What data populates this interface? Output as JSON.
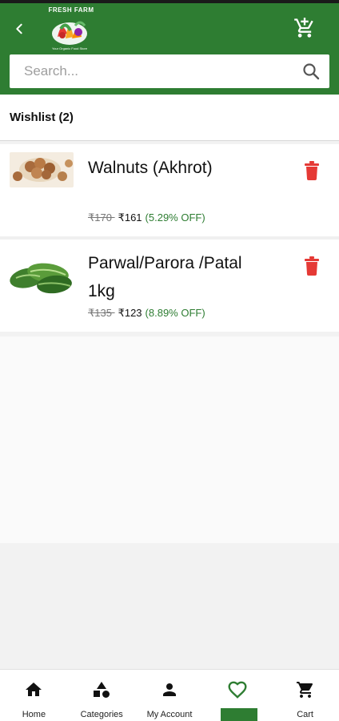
{
  "header": {
    "logo_title": "FRESH FARM",
    "logo_tagline": "Your Organic Food Store",
    "icons": {
      "back": "back-arrow-icon",
      "cart_add": "cart-add-icon"
    },
    "brand_color": "#2e7d32"
  },
  "search": {
    "placeholder": "Search...",
    "value": ""
  },
  "wishlist": {
    "title": "Wishlist (2)",
    "items": [
      {
        "name": "Walnuts (Akhrot)",
        "price_old": "₹170 ",
        "price_new": "₹161",
        "discount": "(5.29% OFF)",
        "image": "walnuts"
      },
      {
        "name": "Parwal/Parora /Patal 1kg",
        "price_old": "₹135 ",
        "price_new": "₹123",
        "discount": "(8.89% OFF)",
        "image": "parwal"
      }
    ]
  },
  "nav": {
    "items": [
      {
        "label": "Home",
        "icon": "home-icon"
      },
      {
        "label": "Categories",
        "icon": "categories-icon"
      },
      {
        "label": "My Account",
        "icon": "account-icon"
      },
      {
        "label": "",
        "icon": "heart-icon",
        "active": true
      },
      {
        "label": "Cart",
        "icon": "cart-icon"
      }
    ]
  }
}
